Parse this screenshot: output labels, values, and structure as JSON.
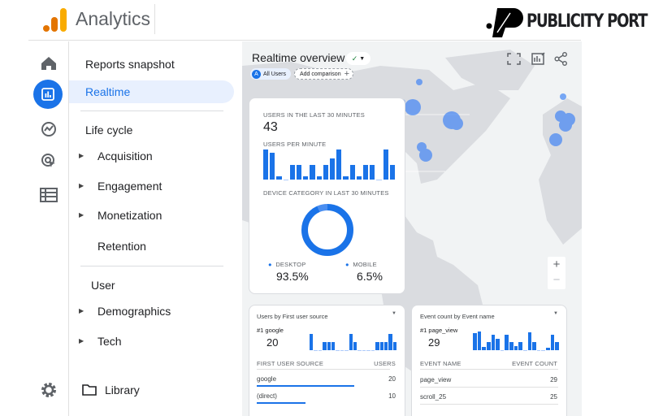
{
  "header": {
    "app_name": "Analytics",
    "brand_logo_text": "PUBLICITY PORT"
  },
  "rail": {
    "icons": [
      "home-icon",
      "reports-icon",
      "explore-icon",
      "advertising-icon",
      "configure-icon",
      "settings-icon"
    ]
  },
  "nav": {
    "reports_snapshot": "Reports snapshot",
    "realtime": "Realtime",
    "life_cycle": "Life cycle",
    "acquisition": "Acquisition",
    "engagement": "Engagement",
    "monetization": "Monetization",
    "retention": "Retention",
    "user": "User",
    "demographics": "Demographics",
    "tech": "Tech",
    "library": "Library"
  },
  "main": {
    "title": "Realtime overview",
    "audience_badge": "A",
    "audience": "All Users",
    "add_comparison": "Add comparison",
    "users_card": {
      "label": "USERS IN THE LAST 30 MINUTES",
      "value": "43",
      "per_minute_label": "USERS PER MINUTE",
      "users_per_minute": [
        4,
        3.6,
        0.4,
        0,
        2,
        2,
        0.4,
        2,
        0.4,
        2,
        2.8,
        4,
        0.4,
        2,
        0.4,
        2,
        2,
        0,
        4,
        2
      ],
      "device_label": "DEVICE CATEGORY IN LAST 30 MINUTES",
      "desktop_label": "DESKTOP",
      "desktop_value": "93.5%",
      "mobile_label": "MOBILE",
      "mobile_value": "6.5%",
      "desktop_fraction": 0.935
    },
    "source_card": {
      "title": "Users by First user source",
      "top": "#1 google",
      "top_value": "20",
      "bars": [
        4,
        0,
        0,
        2,
        2,
        2,
        0,
        0,
        0,
        4,
        2,
        0,
        0,
        0,
        0,
        2,
        2,
        2,
        4,
        2
      ],
      "col1": "FIRST USER SOURCE",
      "col2": "USERS",
      "rows": [
        {
          "name": "google",
          "value": "20",
          "fraction": 1
        },
        {
          "name": "(direct)",
          "value": "10",
          "fraction": 0.5
        }
      ]
    },
    "event_card": {
      "title": "Event count by Event name",
      "top": "#1 page_view",
      "top_value": "29",
      "bars": [
        4,
        4.4,
        0.8,
        2,
        3.6,
        2.6,
        0,
        3.6,
        2,
        1,
        2,
        0,
        4.2,
        2,
        0,
        0,
        0.6,
        3.6,
        2
      ],
      "col1": "EVENT NAME",
      "col2": "EVENT COUNT",
      "rows": [
        {
          "name": "page_view",
          "value": "29"
        },
        {
          "name": "scroll_25",
          "value": "25"
        }
      ]
    },
    "colors": {
      "accent": "#1a73e8",
      "map_land": "#dadce0",
      "map_water": "#f1f3f4",
      "bubble": "#4285f4"
    }
  }
}
